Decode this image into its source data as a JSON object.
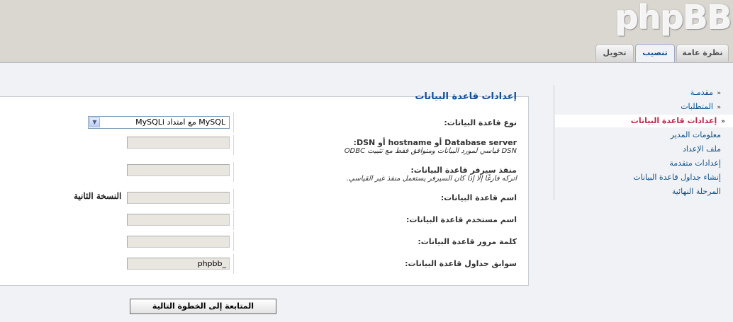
{
  "header": {
    "logo": "phpBB",
    "tabs": [
      {
        "label": "نظرة عامة"
      },
      {
        "label": "تنصيب"
      },
      {
        "label": "تحويل"
      }
    ]
  },
  "sidebar": {
    "items": [
      {
        "label": "مقدمـة",
        "marker": "«"
      },
      {
        "label": "المتطلبات",
        "marker": "«"
      },
      {
        "label": "إعدادات قاعدة البيانات",
        "marker": "«"
      },
      {
        "label": "معلومات المدير"
      },
      {
        "label": "ملف الإعداد"
      },
      {
        "label": "إعدادات متقدمة"
      },
      {
        "label": "إنشاء جداول قاعدة البيانات"
      },
      {
        "label": "المرحلة النهائية"
      }
    ]
  },
  "main": {
    "title": "إعدادات قاعدة البيانات",
    "dbtype": {
      "label": "نوع قاعدة البيانات:",
      "value": "MySQL مع امتداد MySQLi"
    },
    "dbhost": {
      "label": "Database server أو hostname أو DSN:",
      "explain": "DSN قياسي لمورد البيانات ومتوافق فقط مع تثبيت ODBC",
      "value": ""
    },
    "dbport": {
      "label": "منفذ سيرفر قاعدة البيانات:",
      "explain": "اتركه فارغًا إلا إذا كان السيرفر يستعمل منفذ غير القياسي.",
      "value": ""
    },
    "dbname": {
      "label": "اسم قاعدة البيانات:",
      "value": ""
    },
    "dbuser": {
      "label": "اسم مستخدم قاعدة البيانات:",
      "value": ""
    },
    "dbpasswd": {
      "label": "كلمة مرور قاعدة البيانات:",
      "value": ""
    },
    "table_prefix": {
      "label": "سوابق جداول قاعدة البيانات:",
      "value": "phpbb_"
    },
    "annotation": "النسخة الثانية",
    "submit_label": "المتابعة إلى الخطوة التالية"
  }
}
